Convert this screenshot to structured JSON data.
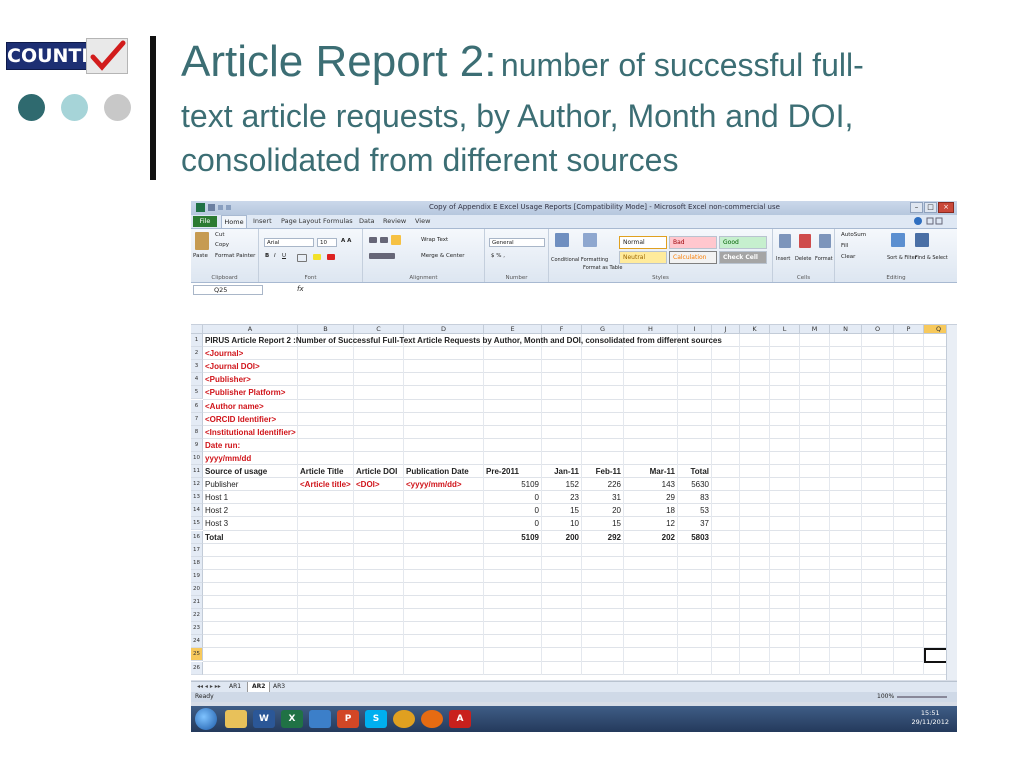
{
  "slide": {
    "logo_text": "COUNTER",
    "title_main": "Article Report 2:",
    "title_sub_line1": "number of successful full-",
    "title_line2": "text article requests, by Author, Month and DOI,",
    "title_line3": "consolidated from different sources",
    "dot_colors": [
      "#2f6a6f",
      "#a6d4d8",
      "#c8c8c8"
    ],
    "title_color": "#3c6e74"
  },
  "excel": {
    "window_title": "Copy of Appendix E Excel Usage Reports  [Compatibility Mode]  -  Microsoft Excel non-commercial use",
    "menu": [
      "File",
      "Home",
      "Insert",
      "Page Layout",
      "Formulas",
      "Data",
      "Review",
      "View"
    ],
    "ribbon": {
      "clipboard": {
        "label": "Clipboard",
        "paste": "Paste",
        "cut": "Cut",
        "copy": "Copy",
        "format_painter": "Format Painter"
      },
      "font": {
        "label": "Font",
        "font_name": "Arial",
        "font_size": "10"
      },
      "alignment": {
        "label": "Alignment",
        "wrap": "Wrap Text",
        "merge": "Merge & Center"
      },
      "number": {
        "label": "Number",
        "format": "General"
      },
      "styles": {
        "label": "Styles",
        "conditional": "Conditional Formatting",
        "format_table": "Format as Table",
        "normal": "Normal",
        "bad": "Bad",
        "good": "Good",
        "neutral": "Neutral",
        "calculation": "Calculation",
        "check_cell": "Check Cell"
      },
      "cells": {
        "label": "Cells",
        "insert": "Insert",
        "delete": "Delete",
        "format": "Format"
      },
      "editing": {
        "label": "Editing",
        "autosum": "AutoSum",
        "fill": "Fill",
        "clear": "Clear",
        "sort": "Sort & Filter",
        "find": "Find & Select"
      }
    },
    "name_box": "Q25",
    "fx": "fx",
    "columns": [
      "A",
      "B",
      "C",
      "D",
      "E",
      "F",
      "G",
      "H",
      "I",
      "J",
      "K",
      "L",
      "M",
      "N",
      "O",
      "P",
      "Q"
    ],
    "selected_column": "Q",
    "selected_row": "25",
    "rows": [
      "1",
      "2",
      "3",
      "4",
      "5",
      "6",
      "7",
      "8",
      "9",
      "10",
      "11",
      "12",
      "13",
      "14",
      "15",
      "16",
      "17",
      "18",
      "19",
      "20",
      "21",
      "22",
      "23",
      "24",
      "25",
      "26"
    ],
    "cells": {
      "r1": "PIRUS Article Report 2 :Number of Successful Full-Text Article Requests by Author, Month and DOI, consolidated from different sources",
      "r2": "<Journal>",
      "r3": "<Journal DOI>",
      "r4": "<Publisher>",
      "r5": "<Publisher Platform>",
      "r6": "<Author name>",
      "r7": "<ORCID Identifier>",
      "r8": "<Institutional Identifier>",
      "r9": "Date run:",
      "r10": "yyyy/mm/dd"
    },
    "table_header": [
      "Source of usage",
      "Article Title",
      "Article  DOI",
      "Publication Date",
      "Pre-2011",
      "Jan-11",
      "Feb-11",
      "Mar-11",
      "Total"
    ],
    "table_rows": [
      [
        "Publisher",
        "<Article title>",
        "<DOI>",
        "<yyyy/mm/dd>",
        "5109",
        "152",
        "226",
        "143",
        "5630"
      ],
      [
        "Host 1",
        "",
        "",
        "",
        "0",
        "23",
        "31",
        "29",
        "83"
      ],
      [
        "Host 2",
        "",
        "",
        "",
        "0",
        "15",
        "20",
        "18",
        "53"
      ],
      [
        "Host 3",
        "",
        "",
        "",
        "0",
        "10",
        "15",
        "12",
        "37"
      ],
      [
        "Total",
        "",
        "",
        "",
        "5109",
        "200",
        "292",
        "202",
        "5803"
      ]
    ],
    "sheet_tabs": [
      "AR1",
      "AR2",
      "AR3"
    ],
    "active_sheet": "AR2",
    "status": "Ready",
    "zoom": "100%",
    "clock_time": "15:51",
    "clock_date": "29/11/2012"
  }
}
